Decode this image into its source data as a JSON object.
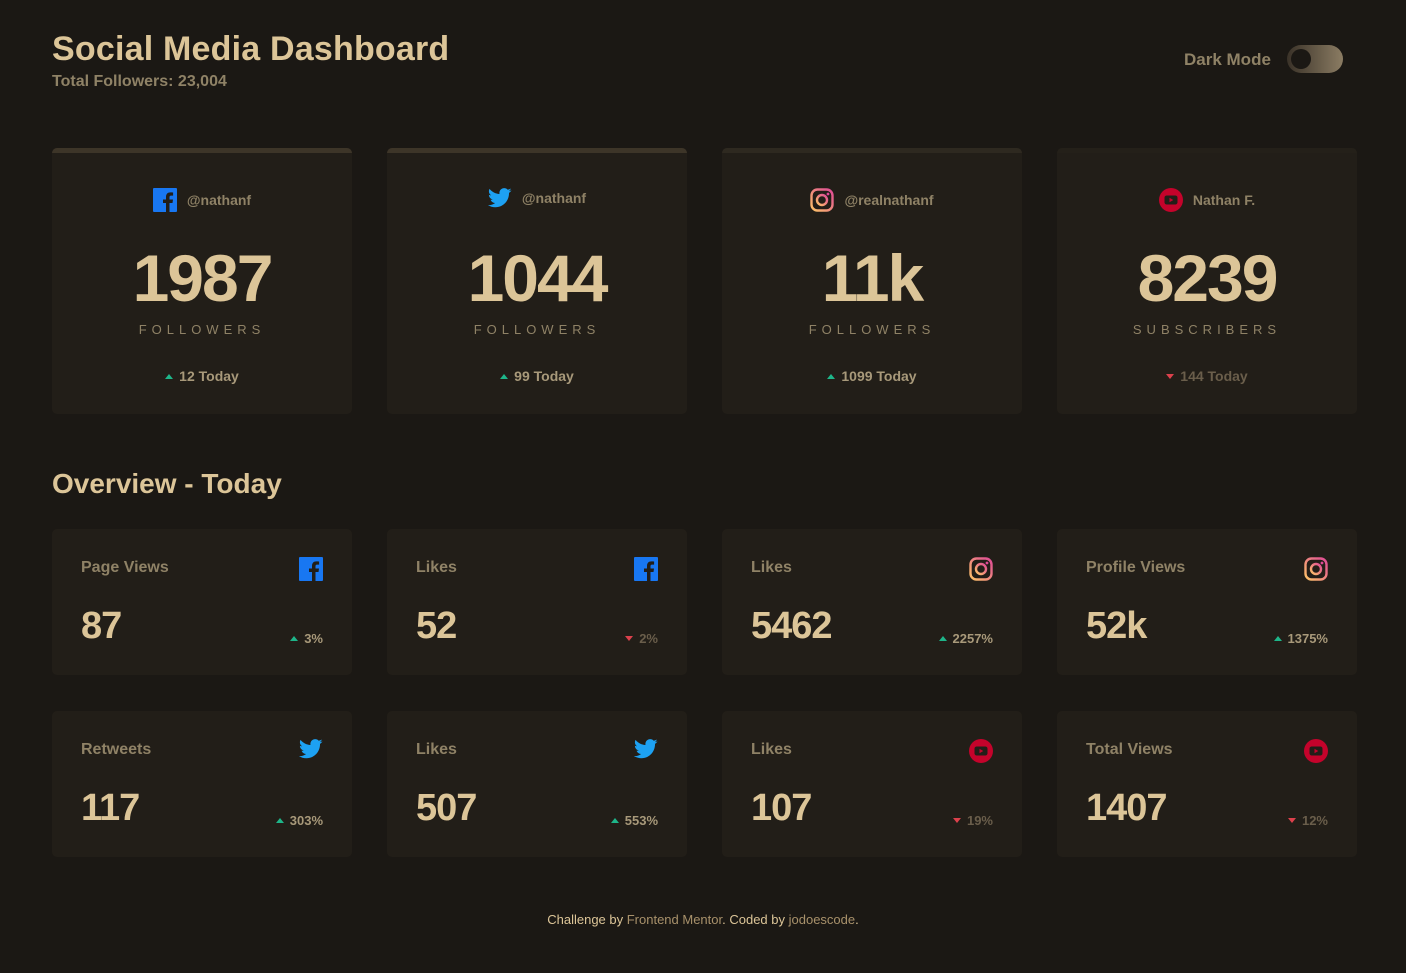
{
  "header": {
    "title": "Social Media Dashboard",
    "total_followers": "Total Followers: 23,004",
    "dark_mode_label": "Dark Mode"
  },
  "colors": {
    "facebook": "#1877f2",
    "twitter": "#1da1f2",
    "instagram": "#e1306c",
    "youtube": "#c4032b",
    "up": "#1eb589",
    "down": "#dc414c"
  },
  "cards": [
    {
      "handle": "@nathanf",
      "count": "1987",
      "unit": "FOLLOWERS",
      "change": "12 Today",
      "direction": "up",
      "icon": "facebook-icon"
    },
    {
      "handle": "@nathanf",
      "count": "1044",
      "unit": "FOLLOWERS",
      "change": "99 Today",
      "direction": "up",
      "icon": "twitter-icon"
    },
    {
      "handle": "@realnathanf",
      "count": "11k",
      "unit": "FOLLOWERS",
      "change": "1099 Today",
      "direction": "up",
      "icon": "instagram-icon"
    },
    {
      "handle": "Nathan F.",
      "count": "8239",
      "unit": "SUBSCRIBERS",
      "change": "144 Today",
      "direction": "down",
      "icon": "youtube-icon"
    }
  ],
  "overview": {
    "title": "Overview - Today",
    "items": [
      {
        "label": "Page Views",
        "value": "87",
        "change": "3%",
        "direction": "up",
        "icon": "facebook-icon"
      },
      {
        "label": "Likes",
        "value": "52",
        "change": "2%",
        "direction": "down",
        "icon": "facebook-icon"
      },
      {
        "label": "Likes",
        "value": "5462",
        "change": "2257%",
        "direction": "up",
        "icon": "instagram-icon"
      },
      {
        "label": "Profile Views",
        "value": "52k",
        "change": "1375%",
        "direction": "up",
        "icon": "instagram-icon"
      },
      {
        "label": "Retweets",
        "value": "117",
        "change": "303%",
        "direction": "up",
        "icon": "twitter-icon"
      },
      {
        "label": "Likes",
        "value": "507",
        "change": "553%",
        "direction": "up",
        "icon": "twitter-icon"
      },
      {
        "label": "Likes",
        "value": "107",
        "change": "19%",
        "direction": "down",
        "icon": "youtube-icon"
      },
      {
        "label": "Total Views",
        "value": "1407",
        "change": "12%",
        "direction": "down",
        "icon": "youtube-icon"
      }
    ]
  },
  "footer": {
    "prefix": "Challenge by ",
    "link1": "Frontend Mentor",
    "middle": ". Coded by ",
    "link2": "jodoescode",
    "suffix": "."
  }
}
